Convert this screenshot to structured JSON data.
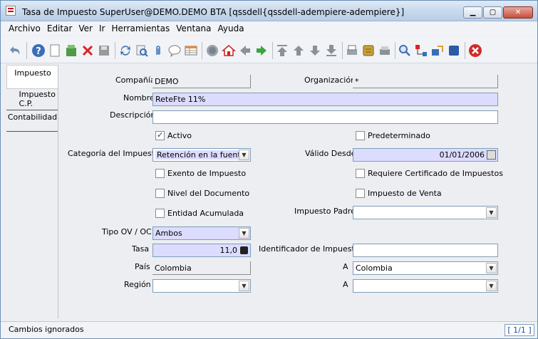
{
  "window": {
    "title": "Tasa de Impuesto  SuperUser@DEMO.DEMO BTA [qssdell{qssdell-adempiere-adempiere}]",
    "minimize_icon": "minimize-icon",
    "maximize_icon": "maximize-icon",
    "close_icon": "close-icon"
  },
  "menu": {
    "items": [
      "Archivo",
      "Editar",
      "Ver",
      "Ir",
      "Herramientas",
      "Ventana",
      "Ayuda"
    ]
  },
  "toolbar": {
    "buttons": [
      "undo-icon",
      "help-icon",
      "new-record-icon",
      "copy-record-icon",
      "delete-icon",
      "save-icon",
      "refresh-icon",
      "find-icon",
      "attachment-icon",
      "chat-icon",
      "grid-toggle-icon",
      "history-icon",
      "home-icon",
      "previous-window-icon",
      "next-window-icon",
      "first-record-icon",
      "previous-record-icon",
      "next-record-icon",
      "last-record-icon",
      "report-icon",
      "archive-icon",
      "print-icon",
      "zoom-across-icon",
      "active-workflows-icon",
      "product-info-icon",
      "end-icon"
    ]
  },
  "tabs": [
    {
      "label": "Impuesto",
      "active": true
    },
    {
      "label": "Impuesto C.P.",
      "active": false
    },
    {
      "label": "Contabilidad",
      "active": false
    }
  ],
  "form": {
    "company": {
      "label": "Compañía",
      "value": "DEMO"
    },
    "organization": {
      "label": "Organización",
      "value": "*"
    },
    "name": {
      "label": "Nombre",
      "value": "ReteFte 11%"
    },
    "description": {
      "label": "Descripción",
      "value": ""
    },
    "active": {
      "label": "Activo",
      "checked": true
    },
    "default": {
      "label": "Predeterminado",
      "checked": false
    },
    "tax_category": {
      "label": "Categoría del Impuesto",
      "value": "Retención en la fuente"
    },
    "valid_from": {
      "label": "Válido Desde",
      "value": "01/01/2006"
    },
    "tax_exempt": {
      "label": "Exento de Impuesto",
      "checked": false
    },
    "requires_tax_cert": {
      "label": "Requiere Certificado de Impuestos",
      "checked": false
    },
    "document_level": {
      "label": "Nivel del Documento",
      "checked": false
    },
    "sales_tax": {
      "label": "Impuesto de Venta",
      "checked": false
    },
    "summary_level": {
      "label": "Entidad Acumulada",
      "checked": false
    },
    "parent_tax": {
      "label": "Impuesto Padre",
      "value": ""
    },
    "so_po_type": {
      "label": "Tipo OV / OC",
      "value": "Ambos"
    },
    "rate": {
      "label": "Tasa",
      "value": "11,0"
    },
    "tax_indicator": {
      "label": "Identificador de Impuesto",
      "value": ""
    },
    "country": {
      "label": "País",
      "value": "Colombia"
    },
    "to_country": {
      "label": "A",
      "value": "Colombia"
    },
    "region": {
      "label": "Región",
      "value": ""
    },
    "to_region": {
      "label": "A",
      "value": ""
    }
  },
  "status": {
    "message": "Cambios ignorados",
    "page": "[ 1/1 ]"
  }
}
